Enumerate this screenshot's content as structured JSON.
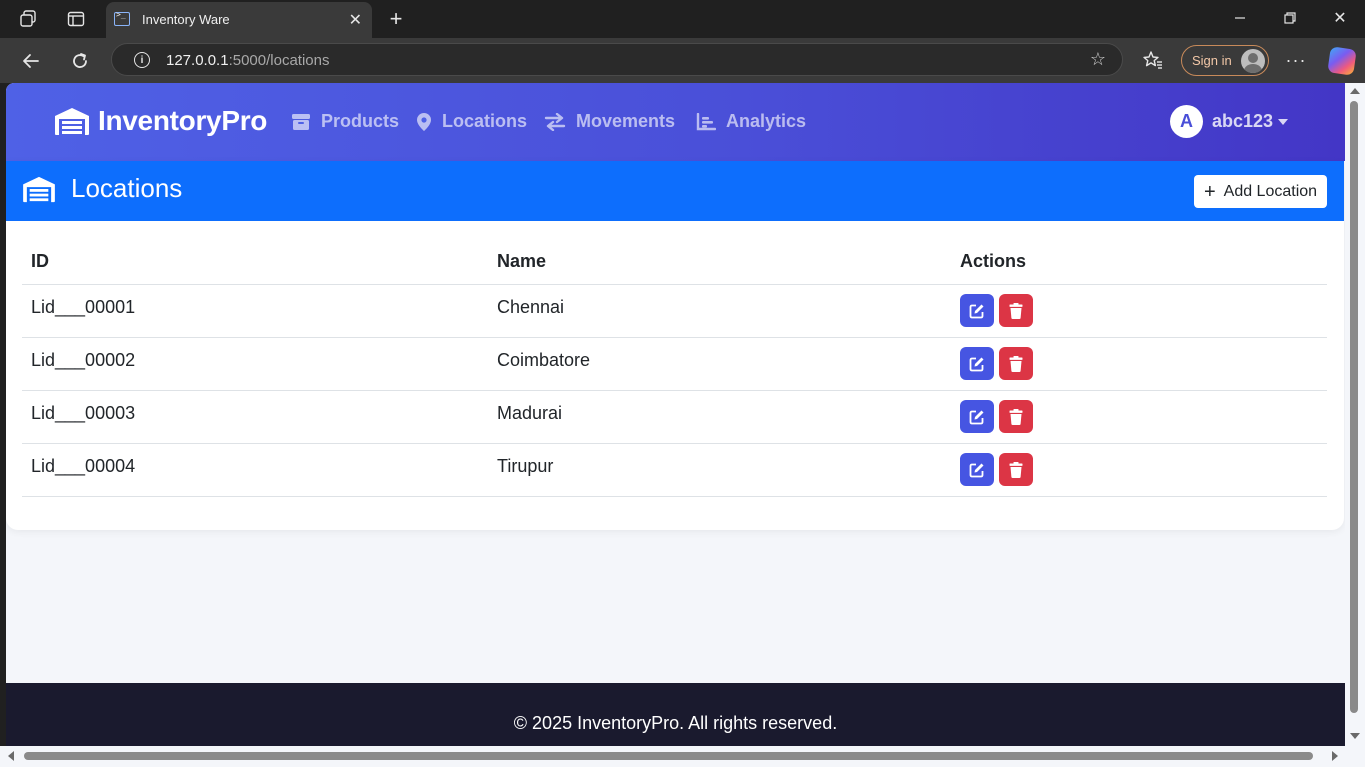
{
  "browser": {
    "tab_title": "Inventory Ware",
    "url_host": "127.0.0.1",
    "url_rest": ":5000/locations",
    "sign_in_label": "Sign in"
  },
  "navbar": {
    "brand": "InventoryPro",
    "items": [
      {
        "label": "Products",
        "icon": "box-icon"
      },
      {
        "label": "Locations",
        "icon": "map-marker-icon"
      },
      {
        "label": "Movements",
        "icon": "exchange-icon"
      },
      {
        "label": "Analytics",
        "icon": "chart-icon"
      }
    ],
    "user": {
      "initial": "A",
      "name": "abc123"
    },
    "gradient": [
      "#4f61e6",
      "#4336c6"
    ]
  },
  "page": {
    "title": "Locations",
    "add_button_label": "Add Location",
    "header_color": "#0d6efd"
  },
  "table": {
    "columns": [
      "ID",
      "Name",
      "Actions"
    ],
    "rows": [
      {
        "id": "Lid___00001",
        "name": "Chennai"
      },
      {
        "id": "Lid___00002",
        "name": "Coimbatore"
      },
      {
        "id": "Lid___00003",
        "name": "Madurai"
      },
      {
        "id": "Lid___00004",
        "name": "Tirupur"
      }
    ],
    "edit_color": "#4655e2",
    "delete_color": "#dc3545"
  },
  "footer": {
    "text": "© 2025 InventoryPro. All rights reserved."
  }
}
